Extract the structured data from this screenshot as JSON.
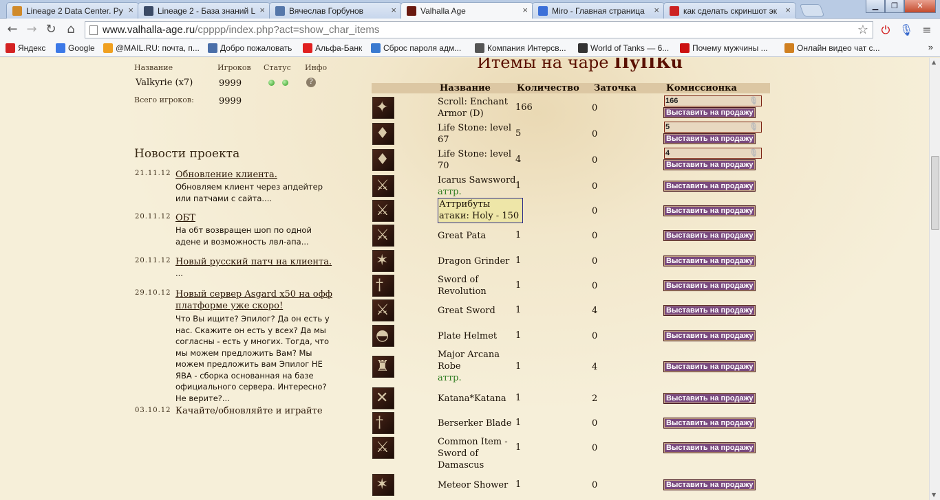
{
  "browser": {
    "tabs": [
      {
        "title": "Lineage 2 Data Center. Ру",
        "color": "#d08a2a"
      },
      {
        "title": "Lineage 2 - База знаний L",
        "color": "#3a4a66"
      },
      {
        "title": "Вячеслав Горбунов",
        "color": "#5577aa"
      },
      {
        "title": "Valhalla Age",
        "color": "#6a1a10"
      },
      {
        "title": "Miro - Главная страница",
        "color": "#3b6fd8"
      },
      {
        "title": "как сделать скриншот эк",
        "color": "#cc2222"
      }
    ],
    "url_host": "www.valhalla-age.ru",
    "url_path": "/cpppp/index.php?act=show_char_items",
    "bookmarks": [
      {
        "label": "Яндекс",
        "color": "#d42222"
      },
      {
        "label": "Google",
        "color": "#3b78e7"
      },
      {
        "label": "@MAIL.RU: почта, п...",
        "color": "#f0a020"
      },
      {
        "label": "Добро пожаловать",
        "color": "#4a6ea8"
      },
      {
        "label": "Альфа-Банк",
        "color": "#e02020"
      },
      {
        "label": "Сброс пароля адм...",
        "color": "#3a7ad0"
      },
      {
        "label": "Компания Интерсв...",
        "color": "#555555"
      },
      {
        "label": "World of Tanks — 6...",
        "color": "#333333"
      },
      {
        "label": "Почему мужчины ...",
        "color": "#cc1111"
      },
      {
        "label": "Онлайн видео чат с...",
        "color": "#d08020"
      }
    ],
    "bookmarks_more": "»"
  },
  "servers": {
    "headers": {
      "name": "Название",
      "players": "Игроков",
      "status": "Статус",
      "info": "Инфо"
    },
    "rows": [
      {
        "name": "Valkyrie (x7)",
        "players": "9999"
      }
    ],
    "total_label": "Всего игроков:",
    "total_value": "9999"
  },
  "news": {
    "title": "Новости проекта",
    "items": [
      {
        "date": "21.11.12",
        "title": "Обновление клиента.",
        "text": "Обновляем клиент через апдейтер или патчами с сайта...."
      },
      {
        "date": "20.11.12",
        "title": "ОБТ",
        "text": "На обт возвращен шоп по одной адене и возможность лвл-апа..."
      },
      {
        "date": "20.11.12",
        "title": "Новый русский патч на клиента.",
        "text": "..."
      },
      {
        "date": "29.10.12",
        "title": "Новый сервер Asgard x50 на офф платформе уже скоро!",
        "text": "Что Вы ищите? Эпилог? Да он есть у нас. Скажите он есть у всех? Да мы согласны - есть у многих. Тогда, что мы можем предложить Вам? Мы можем предложить вам Эпилог НЕ ЯВА - сборка основанная на базе официального сервера. Интересно? Не верите?..."
      },
      {
        "date": "03.10.12",
        "title": "Качайте/обновляйте и играйте",
        "text": ""
      }
    ]
  },
  "items": {
    "title_prefix": "Итемы на чаре",
    "title_char": "ПуПКu",
    "headers": {
      "name": "Название",
      "qty": "Количество",
      "enchant": "Заточка",
      "market": "Комиссионка"
    },
    "sell_label": "Выставить на продажу",
    "rows": [
      {
        "name": "Scroll: Enchant Armor (D)",
        "qty": "166",
        "enchant": "0",
        "input": "166",
        "icon": "✦"
      },
      {
        "name": "Life Stone: level 67",
        "qty": "5",
        "enchant": "0",
        "input": "5",
        "icon": "♦"
      },
      {
        "name": "Life Stone: level 70",
        "qty": "4",
        "enchant": "0",
        "input": "4",
        "icon": "♦"
      },
      {
        "name": "Icarus Sawsword",
        "attr": "аттр.",
        "qty": "1",
        "enchant": "0",
        "icon": "⚔"
      },
      {
        "name": "",
        "qty": "",
        "enchant": "0",
        "icon": "⚔"
      },
      {
        "name": "Great Pata",
        "qty": "1",
        "enchant": "0",
        "icon": "⚔"
      },
      {
        "name": "Dragon Grinder",
        "qty": "1",
        "enchant": "0",
        "icon": "✶"
      },
      {
        "name": "Sword of Revolution",
        "qty": "1",
        "enchant": "0",
        "icon": "†"
      },
      {
        "name": "Great Sword",
        "qty": "1",
        "enchant": "4",
        "icon": "⚔"
      },
      {
        "name": "Plate Helmet",
        "qty": "1",
        "enchant": "0",
        "icon": "◓"
      },
      {
        "name": "Major Arcana Robe",
        "attr": "аттр.",
        "qty": "1",
        "enchant": "4",
        "icon": "♜"
      },
      {
        "name": "Katana*Katana",
        "qty": "1",
        "enchant": "2",
        "icon": "✕"
      },
      {
        "name": "Berserker Blade",
        "qty": "1",
        "enchant": "0",
        "icon": "†"
      },
      {
        "name": "Common Item - Sword of Damascus",
        "qty": "1",
        "enchant": "0",
        "icon": "⚔"
      },
      {
        "name": "Meteor Shower",
        "qty": "1",
        "enchant": "0",
        "icon": "✶"
      }
    ],
    "tooltip": "Аттрибуты атаки: Holy - 150"
  }
}
